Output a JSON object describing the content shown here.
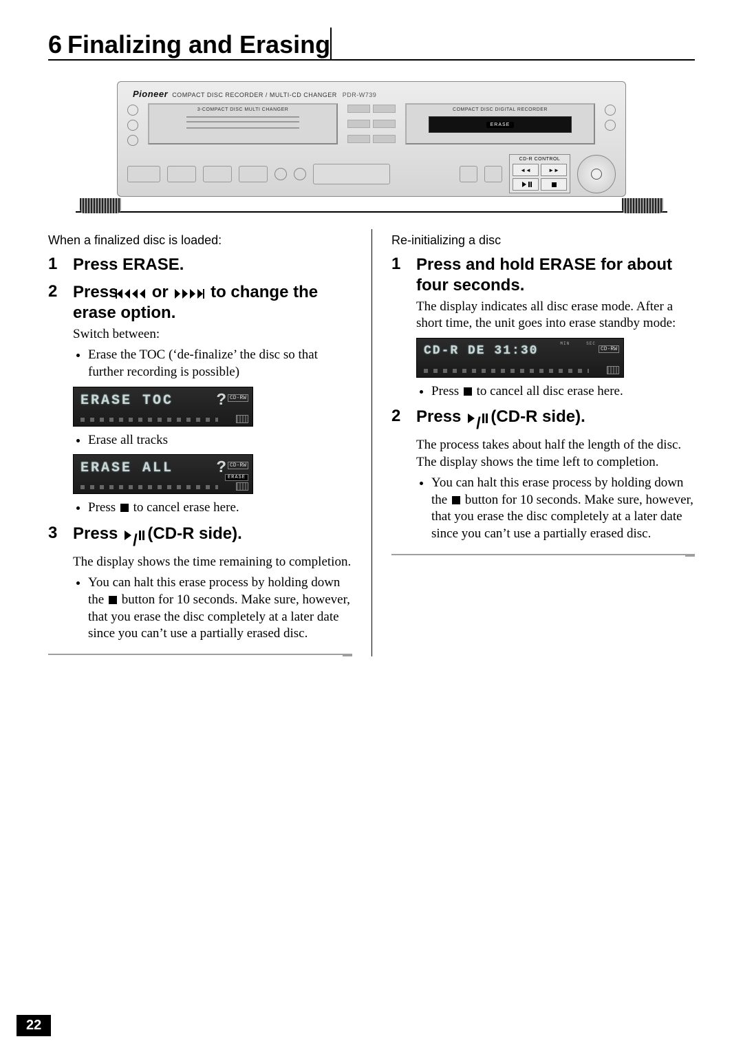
{
  "chapter": {
    "number": "6",
    "title": "Finalizing and Erasing"
  },
  "device": {
    "brand": "Pioneer",
    "subtitle": "COMPACT DISC RECORDER / MULTI-CD CHANGER",
    "model": "PDR-W739",
    "deck_left_label": "3-COMPACT DISC MULTI CHANGER",
    "deck_right_label": "COMPACT DISC DIGITAL RECORDER",
    "erase_pill": "ERASE",
    "cdr_label": "CD-R CONTROL"
  },
  "left": {
    "lead": "When a finalized disc is loaded:",
    "s1_title": "Press ERASE.",
    "s2_pre": "Press ",
    "s2_mid": " or ",
    "s2_post": " to change the erase option.",
    "switch": "Switch between:",
    "opt1": "Erase the TOC (‘de-finalize’ the disc so that further recording is possible)",
    "lcd1_text": "ERASE  TOC",
    "lcd_q": "?",
    "lcd_badge": "CD-RW",
    "opt2": "Erase all tracks",
    "lcd2_text": "ERASE  ALL",
    "lcd2_erase": "ERASE",
    "cancel_pre": "Press ",
    "cancel_post": " to cancel erase here.",
    "s3_pre": "Press ",
    "s3_post": " (CD-R side).",
    "s3_body": "The display shows the time remaining to completion.",
    "s3_halt_pre": "You can halt this erase process by holding down the ",
    "s3_halt_post": " button for 10 seconds. Make sure, however, that you erase the disc completely at a later date since you can’t use a partially erased disc."
  },
  "right": {
    "lead": "Re-initializing a disc",
    "s1_title": "Press and hold ERASE for about four seconds.",
    "s1_body": "The display indicates all disc erase mode. After a short time, the unit goes into erase standby mode:",
    "lcd_text": "CD-R  DE   31:30",
    "lcd_min": "MIN",
    "lcd_sec": "SEC",
    "lcd_badge": "CD-RW",
    "cancel_pre": "Press ",
    "cancel_post": " to cancel all disc erase here.",
    "s2_pre": "Press ",
    "s2_post": " (CD-R side).",
    "s2_body": "The process takes about half the length of the disc. The display shows the time left to completion.",
    "s2_halt_pre": "You can halt this erase process by holding down the ",
    "s2_halt_post": " button for 10 seconds. Make sure, however, that you erase the disc completely at a later date since you can’t use a partially erased disc."
  },
  "page_number": "22"
}
